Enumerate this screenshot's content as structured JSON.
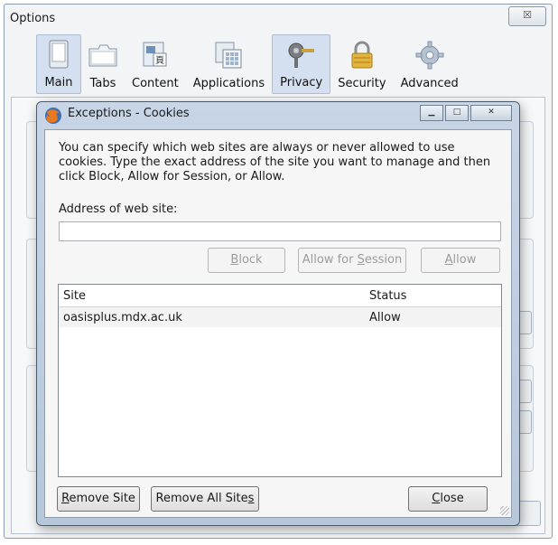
{
  "options_window": {
    "title": "Options",
    "close_label": "☒",
    "toolbar": [
      {
        "label": "Main",
        "icon": "main-window-icon",
        "selected": true
      },
      {
        "label": "Tabs",
        "icon": "tabs-icon",
        "selected": false
      },
      {
        "label": "Content",
        "icon": "content-icon",
        "selected": false
      },
      {
        "label": "Applications",
        "icon": "applications-icon",
        "selected": false
      },
      {
        "label": "Privacy",
        "icon": "privacy-icon",
        "selected": true
      },
      {
        "label": "Security",
        "icon": "padlock-icon",
        "selected": false
      },
      {
        "label": "Advanced",
        "icon": "gear-icon",
        "selected": false
      }
    ]
  },
  "dialog": {
    "title": "Exceptions - Cookies",
    "description": "You can specify which web sites are always or never allowed to use cookies. Type the exact address of the site you want to manage and then click Block, Allow for Session, or Allow.",
    "address_label": "Address of web site:",
    "address_value": "",
    "buttons": {
      "block": {
        "pre": "",
        "key": "B",
        "post": "lock"
      },
      "allow_session": {
        "pre": "Allow for ",
        "key": "S",
        "post": "ession"
      },
      "allow": {
        "pre": "",
        "key": "A",
        "post": "llow"
      },
      "remove_site": {
        "pre": "",
        "key": "R",
        "post": "emove Site"
      },
      "remove_all": {
        "pre": "Remove All Site",
        "key": "s",
        "post": ""
      },
      "close": {
        "pre": "",
        "key": "C",
        "post": "lose"
      }
    },
    "table": {
      "columns": [
        "Site",
        "Status"
      ],
      "rows": [
        {
          "site": "oasisplus.mdx.ac.uk",
          "status": "Allow"
        }
      ]
    }
  },
  "colors": {
    "dialog_frame": "#b7c7db",
    "selected_tab": "#d4dff0",
    "row_highlight": "#f3f3f3"
  }
}
